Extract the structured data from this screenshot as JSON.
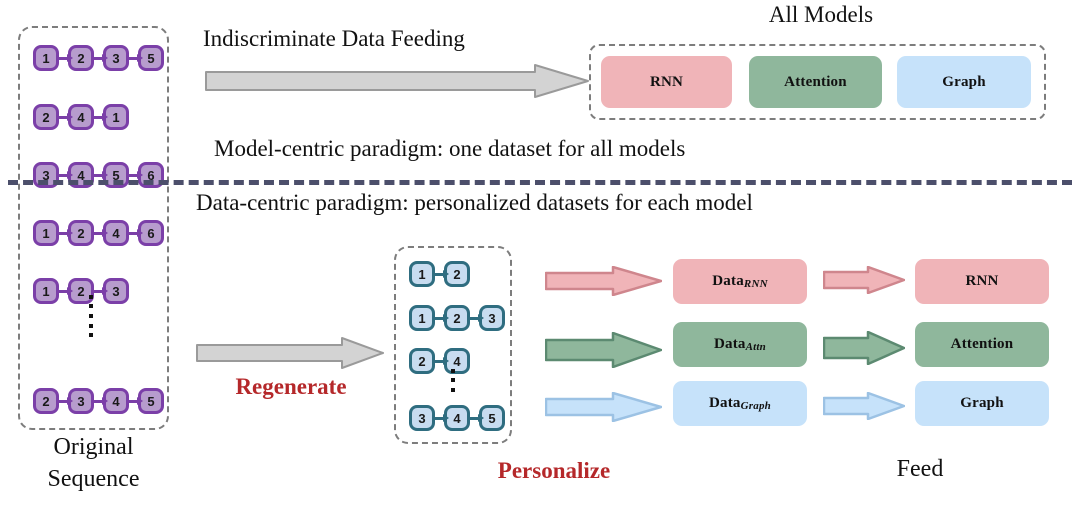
{
  "diagram": {
    "title_all_models": "All Models",
    "top_arrow_label": "Indiscriminate Data Feeding",
    "model_centric_caption": "Model-centric paradigm: one dataset for all models",
    "data_centric_caption": "Data-centric paradigm: personalized datasets for each model",
    "original_sequence_label_line1": "Original",
    "original_sequence_label_line2": "Sequence",
    "regenerate_label": "Regenerate",
    "personalize_label": "Personalize",
    "feed_label": "Feed"
  },
  "original_sequences": {
    "rows": [
      [
        "1",
        "2",
        "3",
        "5"
      ],
      [
        "2",
        "4",
        "1"
      ],
      [
        "3",
        "4",
        "5",
        "6"
      ],
      [
        "1",
        "2",
        "4",
        "6"
      ],
      [
        "1",
        "2",
        "3"
      ],
      [
        "2",
        "3",
        "4",
        "5"
      ]
    ],
    "ellipsis_after_row": 5
  },
  "regenerated_sequences": {
    "rows": [
      [
        "1",
        "2"
      ],
      [
        "1",
        "2",
        "3"
      ],
      [
        "2",
        "4"
      ],
      [
        "3",
        "4",
        "5"
      ]
    ],
    "ellipsis_after_row": 3
  },
  "all_models": {
    "items": [
      {
        "label": "RNN",
        "color": "#f0b4b8"
      },
      {
        "label": "Attention",
        "color": "#8fb79c"
      },
      {
        "label": "Graph",
        "color": "#c6e2fa"
      }
    ]
  },
  "personalized_datasets": [
    {
      "base": "Data",
      "sub": "RNN",
      "color": "#f0b4b8"
    },
    {
      "base": "Data",
      "sub": "Attn",
      "color": "#8fb79c"
    },
    {
      "base": "Data",
      "sub": "Graph",
      "color": "#c6e2fa"
    }
  ],
  "target_models": [
    {
      "label": "RNN",
      "color": "#f0b4b8"
    },
    {
      "label": "Attention",
      "color": "#8fb79c"
    },
    {
      "label": "Graph",
      "color": "#c6e2fa"
    }
  ],
  "colors": {
    "node_purple_fill": "#b79ccd",
    "node_purple_border": "#7b3fa8",
    "node_blue_fill": "#c8dcf0",
    "node_blue_border": "#2f6d80",
    "grey_arrow_fill": "#d3d3d3",
    "grey_arrow_stroke": "#9a9a9a",
    "pink": "#f0b4b8",
    "pink_stroke": "#cf868d",
    "green": "#8fb79c",
    "green_stroke": "#5c8a71",
    "blue": "#c6e2fa",
    "blue_stroke": "#9cc2e4",
    "dashed_border": "#7d7d7d",
    "divider": "#4c4f6b",
    "accent_red": "#b5282a"
  }
}
